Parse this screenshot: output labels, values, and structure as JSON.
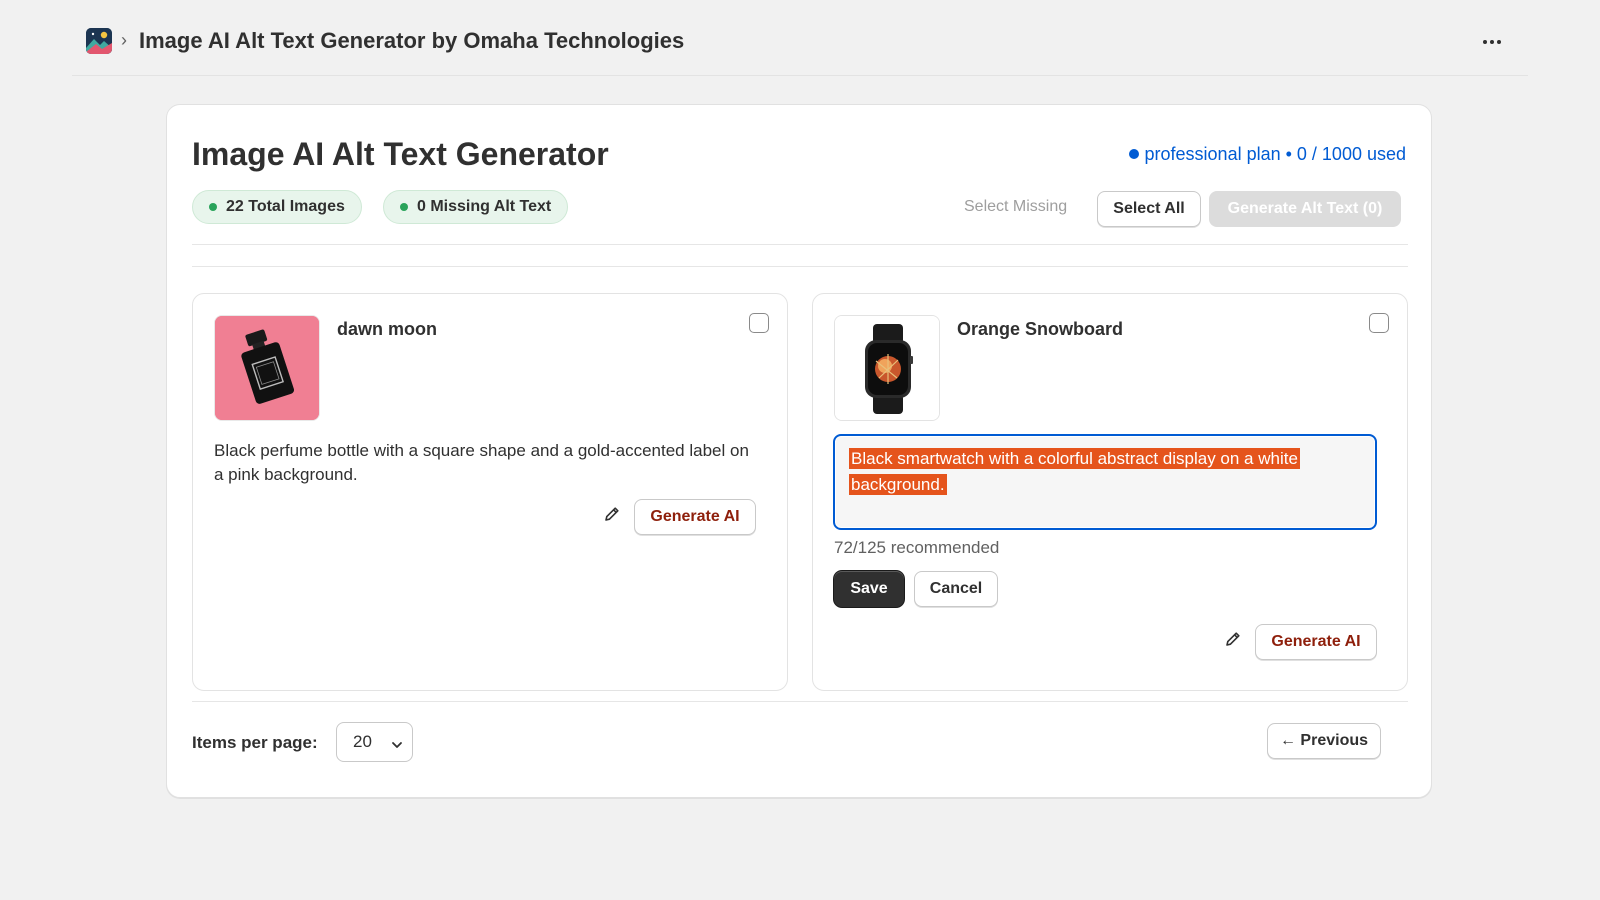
{
  "header": {
    "app_title": "Image AI Alt Text Generator by Omaha Technologies",
    "breadcrumb_separator": "›"
  },
  "page": {
    "title": "Image AI Alt Text Generator",
    "plan_text": "professional plan • 0 / 1000 used"
  },
  "stats": {
    "total_images": "22 Total Images",
    "missing_alt": "0 Missing Alt Text"
  },
  "toolbar": {
    "select_missing": "Select Missing",
    "select_all": "Select All",
    "generate_alt_text": "Generate Alt Text (0)"
  },
  "items": [
    {
      "title": "dawn moon",
      "alt_text": "Black perfume bottle with a square shape and a gold-accented label on a pink background.",
      "generate_label": "Generate AI",
      "checked": false
    },
    {
      "title": "Orange Snowboard",
      "alt_text": "Black smartwatch with a colorful abstract display on a white background.",
      "char_count": "72/125 recommended",
      "save_label": "Save",
      "cancel_label": "Cancel",
      "generate_label": "Generate AI",
      "checked": false
    }
  ],
  "pagination": {
    "items_per_page_label": "Items per page:",
    "items_per_page_value": "20",
    "previous_label": "← Previous"
  },
  "colors": {
    "accent_blue": "#005bd3",
    "badge_green": "#29a35a",
    "generate_text": "#8e1f0b",
    "selection": "#e5541c"
  }
}
